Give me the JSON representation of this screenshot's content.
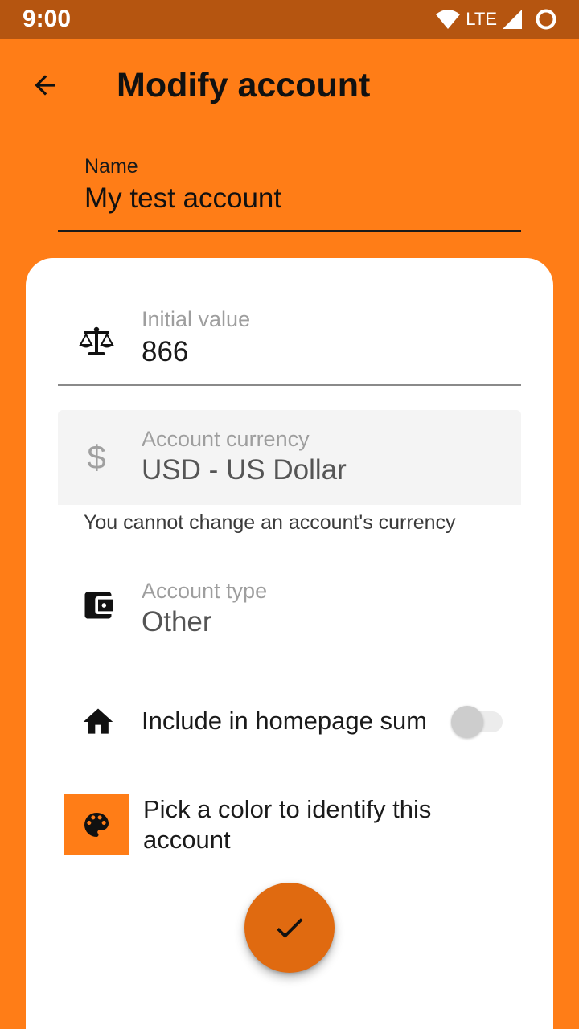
{
  "status_bar": {
    "time": "9:00",
    "network": "LTE",
    "icons": [
      "wifi-icon",
      "cell-signal-icon",
      "circle-indicator-icon"
    ]
  },
  "app_bar": {
    "title": "Modify account",
    "back_icon": "arrow-back-icon"
  },
  "form": {
    "name": {
      "label": "Name",
      "value": "My test account"
    },
    "initial_value": {
      "label": "Initial value",
      "value": "866",
      "icon": "balance-scale-icon"
    },
    "currency": {
      "label": "Account currency",
      "value": "USD - US Dollar",
      "icon": "dollar-icon",
      "disabled": true,
      "helper": "You cannot change an account's currency"
    },
    "account_type": {
      "label": "Account type",
      "value": "Other",
      "icon": "wallet-icon"
    },
    "homepage_sum": {
      "label": "Include in homepage sum",
      "icon": "home-icon",
      "checked": false
    },
    "color": {
      "label": "Pick a color to identify this account",
      "icon": "palette-icon",
      "swatch": "#ff7d17"
    }
  },
  "fab": {
    "icon": "check-icon",
    "color": "#e06a10"
  },
  "colors": {
    "primary": "#ff7d17",
    "status_bar": "#b55510",
    "card": "#ffffff"
  }
}
